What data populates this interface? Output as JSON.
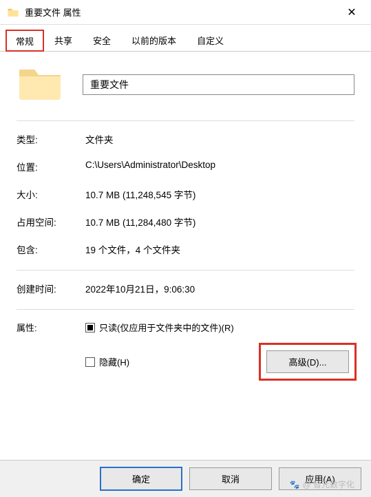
{
  "titlebar": {
    "title": "重要文件 属性"
  },
  "tabs": {
    "general": "常规",
    "share": "共享",
    "security": "安全",
    "previous": "以前的版本",
    "custom": "自定义"
  },
  "name_field": {
    "value": "重要文件"
  },
  "info": {
    "type_label": "类型:",
    "type_value": "文件夹",
    "location_label": "位置:",
    "location_value": "C:\\Users\\Administrator\\Desktop",
    "size_label": "大小:",
    "size_value": "10.7 MB (11,248,545 字节)",
    "disk_label": "占用空间:",
    "disk_value": "10.7 MB (11,284,480 字节)",
    "contains_label": "包含:",
    "contains_value": "19 个文件，4 个文件夹",
    "created_label": "创建时间:",
    "created_value": "2022年10月21日，9:06:30"
  },
  "attributes": {
    "label": "属性:",
    "readonly": "只读(仅应用于文件夹中的文件)(R)",
    "hidden": "隐藏(H)",
    "advanced": "高级(D)..."
  },
  "footer": {
    "ok": "确定",
    "cancel": "取消",
    "apply": "应用(A)"
  },
  "watermark": "@ 智元数字化"
}
